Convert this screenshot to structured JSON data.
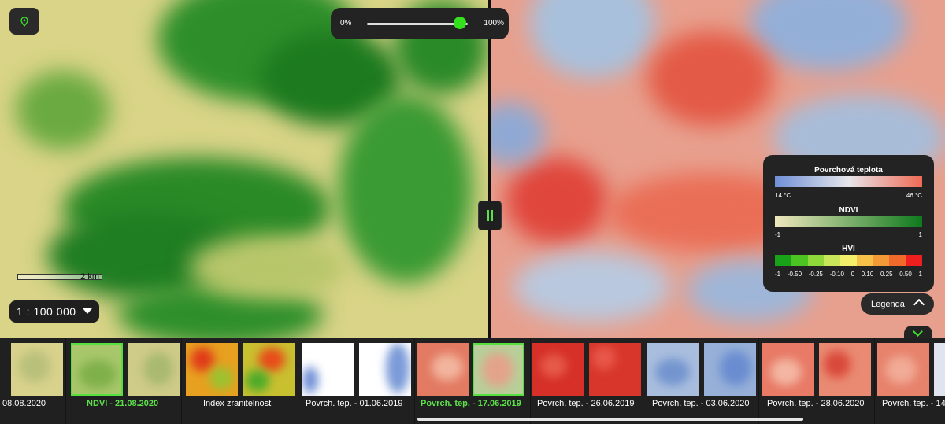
{
  "opacity": {
    "min_label": "0%",
    "max_label": "100%",
    "value": 0.92
  },
  "scale_bar": {
    "label": "2 km"
  },
  "scale_select": {
    "value": "1 : 100 000"
  },
  "legend": {
    "temp_title": "Povrchová teplota",
    "temp_min": "14 °C",
    "temp_max": "46 °C",
    "ndvi_title": "NDVI",
    "ndvi_min": "-1",
    "ndvi_max": "1",
    "hvi_title": "HVI",
    "hvi_labels": [
      "-1",
      "-0.50",
      "-0.25",
      "-0.10",
      "0",
      "0.10",
      "0.25",
      "0.50",
      "1"
    ],
    "hvi_colors": [
      "#1aa11a",
      "#4cc421",
      "#8ed83a",
      "#c9e65a",
      "#f2ef6a",
      "#f7c048",
      "#f39a36",
      "#f06a2c",
      "#ef1f1f"
    ],
    "colors": {
      "temp_low": "#6f8fd6",
      "temp_high": "#ef6a55",
      "ndvi_low": "#efe7bd",
      "ndvi_high": "#0e7a1e"
    }
  },
  "legend_button": {
    "label": "Legenda"
  },
  "timeline": [
    {
      "label": "08.08.2020",
      "active": false
    },
    {
      "label": "NDVI - 21.08.2020",
      "active": true
    },
    {
      "label": "Index zranitelnosti",
      "active": false
    },
    {
      "label": "Povrch. tep. - 01.06.2019",
      "active": false
    },
    {
      "label": "Povrch. tep. - 17.06.2019",
      "active": true
    },
    {
      "label": "Povrch. tep. - 26.06.2019",
      "active": false
    },
    {
      "label": "Povrch. tep. - 03.06.2020",
      "active": false
    },
    {
      "label": "Povrch. tep. - 28.06.2020",
      "active": false
    },
    {
      "label": "Povrch. tep. - 14",
      "active": false
    }
  ]
}
